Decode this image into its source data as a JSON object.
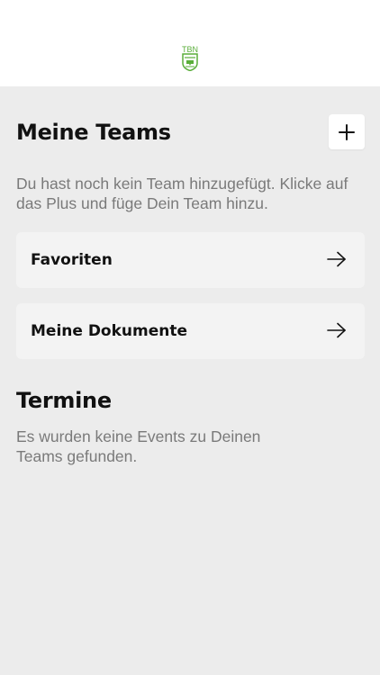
{
  "header": {
    "logo_text": "TBN"
  },
  "teams": {
    "title": "Meine Teams",
    "add_icon": "plus-icon",
    "empty_text": "Du hast noch kein Team hinzugefügt. Klicke auf das Plus und füge Dein Team hinzu."
  },
  "cards": [
    {
      "label": "Favoriten",
      "icon": "arrow-right-icon"
    },
    {
      "label": "Meine Dokumente",
      "icon": "arrow-right-icon"
    }
  ],
  "events": {
    "title": "Termine",
    "empty_text": "Es wurden keine Events zu Deinen Teams gefunden."
  },
  "colors": {
    "background": "#ececec",
    "header_background": "#ffffff",
    "card_background": "#f3f3f3",
    "logo_green": "#5aae3a",
    "heading": "#111111",
    "muted_text": "#7a7a7a"
  }
}
